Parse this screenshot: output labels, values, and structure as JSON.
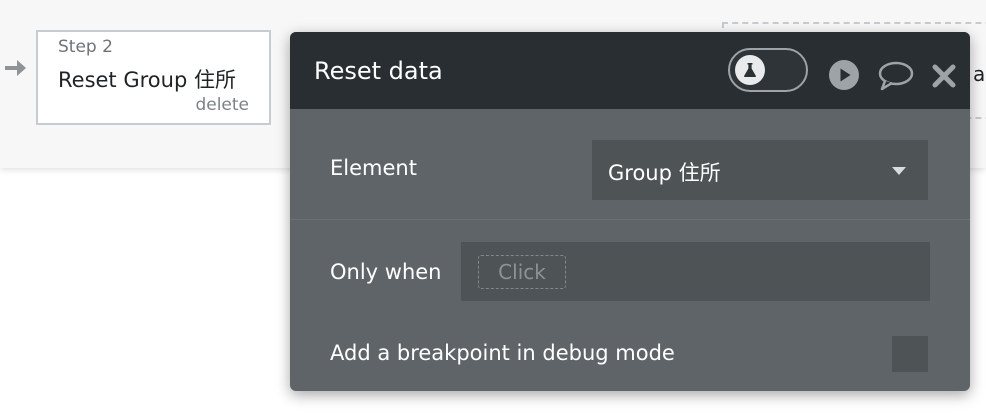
{
  "workflow": {
    "step": {
      "label": "Step 2",
      "title": "Reset Group 住所",
      "delete_label": "delete"
    },
    "next_step_partial_text": "a"
  },
  "panel": {
    "title": "Reset data",
    "header_icons": [
      "flask-icon",
      "play-icon",
      "comment-icon",
      "close-icon"
    ],
    "fields": {
      "element": {
        "label": "Element",
        "value": "Group 住所"
      },
      "only_when": {
        "label": "Only when",
        "placeholder": "Click"
      },
      "breakpoint": {
        "label": "Add a breakpoint in debug mode",
        "checked": false
      }
    }
  },
  "colors": {
    "panel_header_bg": "#282e31",
    "panel_body_bg": "#5f6468",
    "input_bg": "#4e5356",
    "step_border": "#c7ccd1"
  }
}
